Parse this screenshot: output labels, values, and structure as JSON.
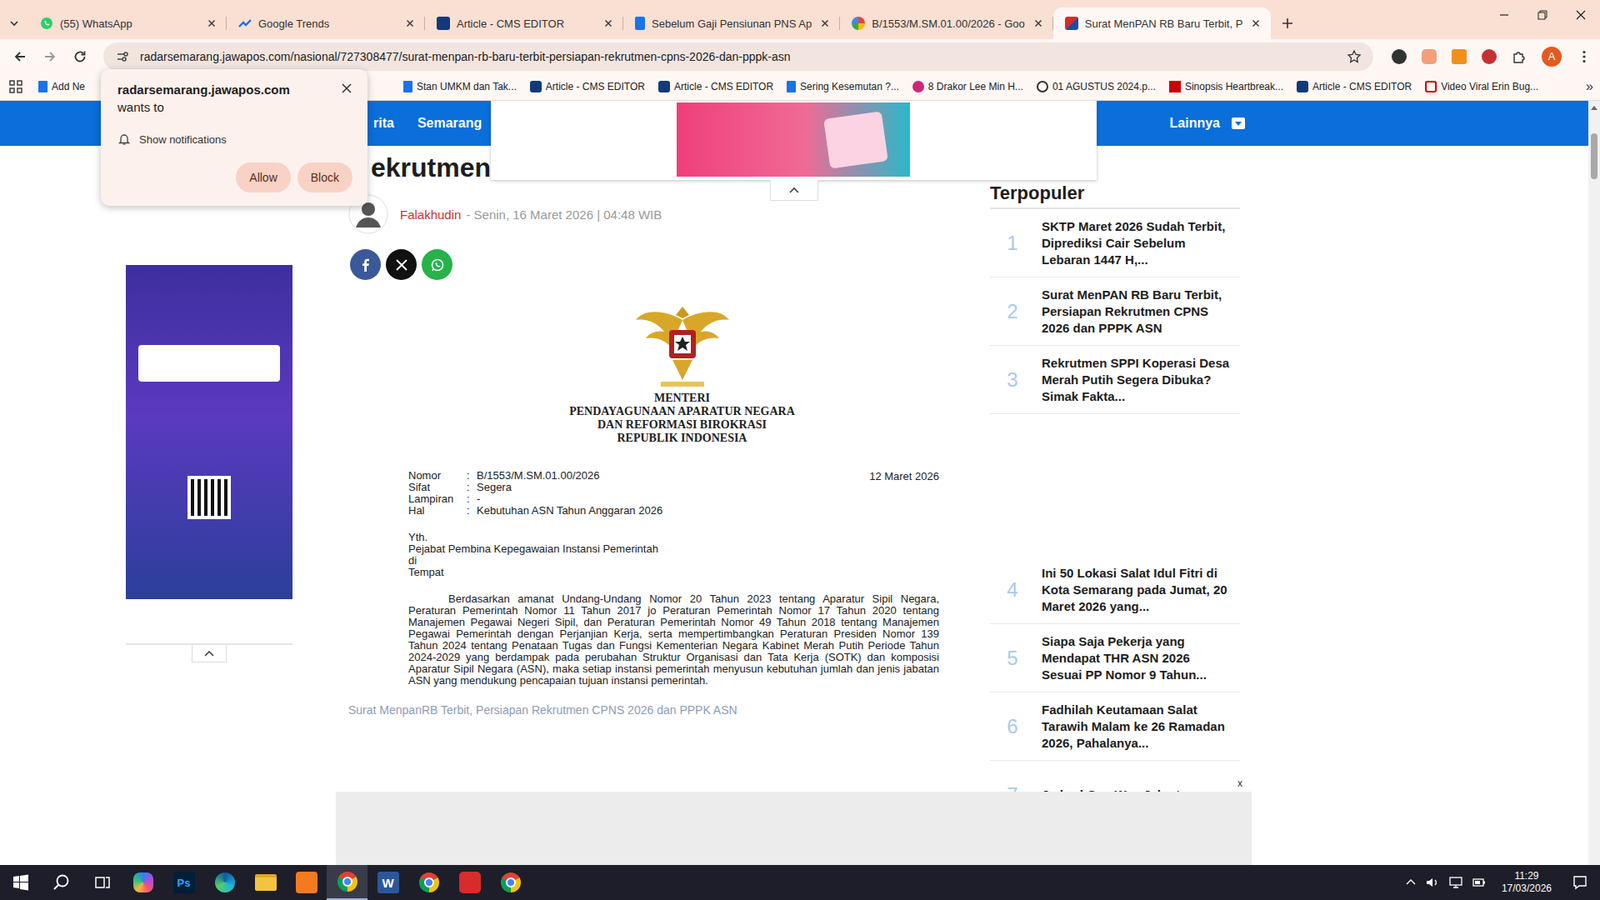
{
  "browser": {
    "tabs": [
      {
        "label": "(55) WhatsApp",
        "kind": "whatsapp",
        "selected": false
      },
      {
        "label": "Google Trends",
        "kind": "trends",
        "selected": false
      },
      {
        "label": "Article - CMS EDITOR",
        "kind": "cms",
        "selected": false
      },
      {
        "label": "Sebelum Gaji Pensiunan PNS Ap",
        "kind": "doc",
        "selected": false
      },
      {
        "label": "B/1553/M.SM.01.00/2026 - Goo",
        "kind": "google",
        "selected": false
      },
      {
        "label": "Surat MenPAN RB Baru Terbit, P",
        "kind": "site",
        "selected": true
      }
    ],
    "url": "radarsemarang.jawapos.com/nasional/727308477/surat-menpan-rb-baru-terbit-persiapan-rekrutmen-cpns-2026-dan-pppk-asn",
    "profile_initial": "A",
    "bookmarks_first": {
      "label": "Add Ne",
      "kind": "doc"
    },
    "bookmarks": [
      {
        "label": "Stan UMKM dan Tak...",
        "kind": "doc"
      },
      {
        "label": "Article - CMS EDITOR",
        "kind": "cms"
      },
      {
        "label": "Article - CMS EDITOR",
        "kind": "cms"
      },
      {
        "label": "Sering Kesemutan ?...",
        "kind": "doc"
      },
      {
        "label": "8 Drakor Lee Min H...",
        "kind": "lu"
      },
      {
        "label": "01 AGUSTUS 2024.p...",
        "kind": "globe"
      },
      {
        "label": "Sinopsis Heartbreak...",
        "kind": "cnn"
      },
      {
        "label": "Article - CMS EDITOR",
        "kind": "cms"
      },
      {
        "label": "Video Viral Erin Bug...",
        "kind": "video"
      }
    ],
    "bookmarks_more": "»"
  },
  "notification_prompt": {
    "site": "radarsemarang.jawapos.com",
    "wants": "wants to",
    "permission": "Show notifications",
    "buttons": [
      "Allow",
      "Block"
    ]
  },
  "nav": {
    "items": [
      "rita",
      "Semarang"
    ],
    "more": "Lainnya"
  },
  "article": {
    "title": "ekrutmen",
    "author": "Falakhudin",
    "date": "- Senin, 16 Maret 2026 | 04:48 WIB",
    "share": [
      "facebook",
      "x",
      "whatsapp"
    ],
    "document": {
      "heading": [
        "MENTERI",
        "PENDAYAGUNAAN APARATUR NEGARA",
        "DAN REFORMASI BIROKRASI",
        "REPUBLIK INDONESIA"
      ],
      "fields": [
        {
          "label": "Nomor",
          "value": "B/1553/M.SM.01.00/2026"
        },
        {
          "label": "Sifat",
          "value": "Segera"
        },
        {
          "label": "Lampiran",
          "value": "-"
        },
        {
          "label": "Hal",
          "value": "Kebutuhan ASN Tahun Anggaran 2026"
        }
      ],
      "separator": ":",
      "date": "12 Maret 2026",
      "address": [
        "Yth.",
        "Pejabat Pembina Kepegawaian Instansi Pemerintah",
        "di",
        "Tempat"
      ],
      "body": "Berdasarkan amanat Undang-Undang Nomor 20 Tahun 2023 tentang Aparatur Sipil Negara, Peraturan Pemerintah Nomor 11 Tahun 2017 jo Peraturan Pemerintah Nomor 17 Tahun 2020 tentang Manajemen Pegawai Negeri Sipil, dan Peraturan Pemerintah Nomor 49 Tahun 2018 tentang Manajemen Pegawai Pemerintah dengan Perjanjian Kerja, serta mempertimbangkan Peraturan Presiden Nomor 139 Tahun 2024 tentang Penataan Tugas dan Fungsi Kementerian Negara Kabinet Merah Putih Periode Tahun 2024-2029 yang berdampak pada perubahan Struktur Organisasi dan Tata Kerja (SOTK) dan komposisi Aparatur Sipil Negara (ASN), maka setiap instansi pemerintah menyusun kebutuhan jumlah dan jenis jabatan ASN yang mendukung pencapaian tujuan instansi pemerintah."
    },
    "caption": "Surat MenpanRB Terbit, Persiapan Rekrutmen CPNS 2026 dan PPPK ASN"
  },
  "sidebar": {
    "heading": "Terpopuler",
    "items": [
      {
        "rank": "1",
        "title": "SKTP Maret 2026 Sudah Terbit, Diprediksi Cair Sebelum Lebaran 1447 H,..."
      },
      {
        "rank": "2",
        "title": "Surat MenPAN RB Baru Terbit, Persiapan Rekrutmen CPNS 2026 dan PPPK ASN"
      },
      {
        "rank": "3",
        "title": "Rekrutmen SPPI Koperasi Desa Merah Putih Segera Dibuka? Simak Fakta..."
      },
      {
        "rank": "4",
        "title": "Ini 50 Lokasi Salat Idul Fitri di Kota Semarang pada Jumat, 20 Maret 2026 yang..."
      },
      {
        "rank": "5",
        "title": "Siapa Saja Pekerja yang Mendapat THR ASN 2026 Sesuai PP Nomor 9 Tahun..."
      },
      {
        "rank": "6",
        "title": "Fadhilah Keutamaan Salat Tarawih Malam ke 26 Ramadan 2026, Pahalanya..."
      },
      {
        "rank": "7",
        "title": "Jadwal One Way Jakarta-"
      }
    ]
  },
  "bottom_ad": {
    "close": "x"
  },
  "taskbar": {
    "apps": [
      {
        "kind": "copilot",
        "active": false
      },
      {
        "kind": "ps",
        "label": "Ps",
        "active": false
      },
      {
        "kind": "edge",
        "active": false
      },
      {
        "kind": "explorer",
        "active": false
      },
      {
        "kind": "orange",
        "active": false
      },
      {
        "kind": "chrome",
        "active": true
      },
      {
        "kind": "word",
        "label": "W",
        "active": false
      },
      {
        "kind": "chrome",
        "active": false
      },
      {
        "kind": "wps",
        "active": false
      },
      {
        "kind": "chrome",
        "active": false
      }
    ],
    "time": "11:29",
    "date": "17/03/2026"
  }
}
